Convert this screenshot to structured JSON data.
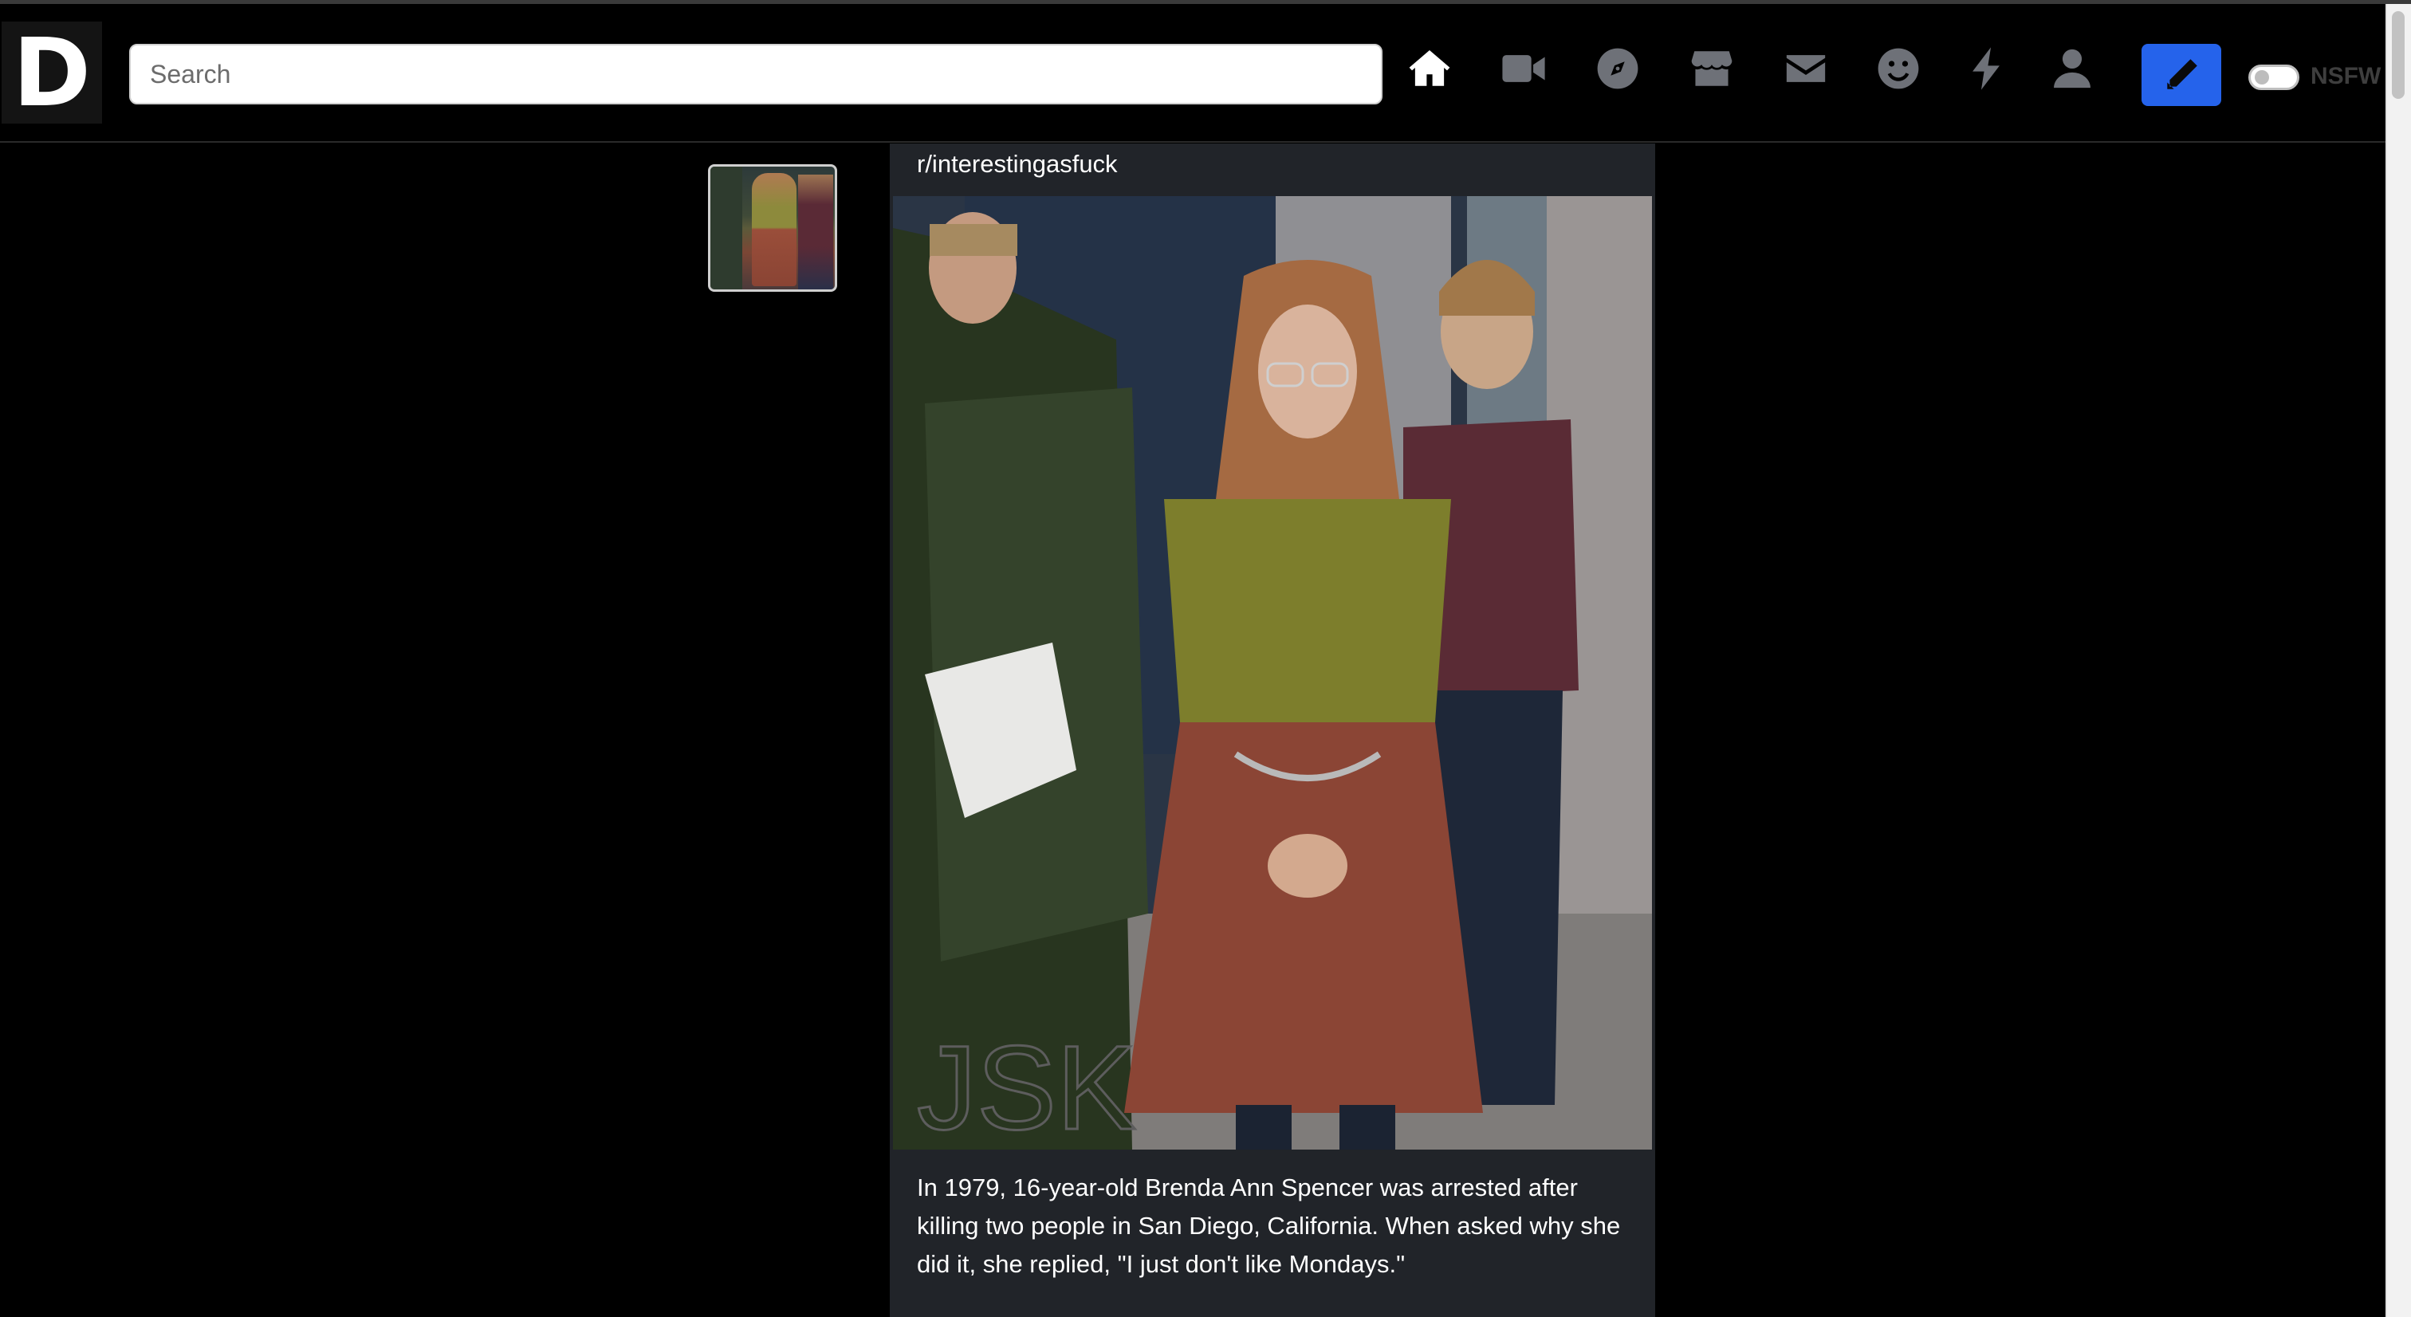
{
  "brand": {
    "logo_letter": "D"
  },
  "search": {
    "placeholder": "Search",
    "value": ""
  },
  "nav": {
    "icons": [
      "home-icon",
      "video-icon",
      "compass-icon",
      "store-icon",
      "mail-icon",
      "smiley-icon",
      "bolt-icon",
      "user-icon"
    ],
    "active": "home-icon",
    "compose_icon": "pencil-icon",
    "nsfw_label": "NSFW",
    "nsfw_on": false
  },
  "colors": {
    "accent": "#2563eb",
    "icon_inactive": "#6e7178",
    "icon_active": "#ffffff",
    "card_bg": "#212429"
  },
  "post": {
    "subreddit": "r/interestingasfuck",
    "caption": "In 1979, 16-year-old Brenda Ann Spencer was arrested after killing two people in San Diego, California. When asked why she did it, she replied, \"I just don't like Mondays.\"",
    "watermark": "JSK"
  }
}
